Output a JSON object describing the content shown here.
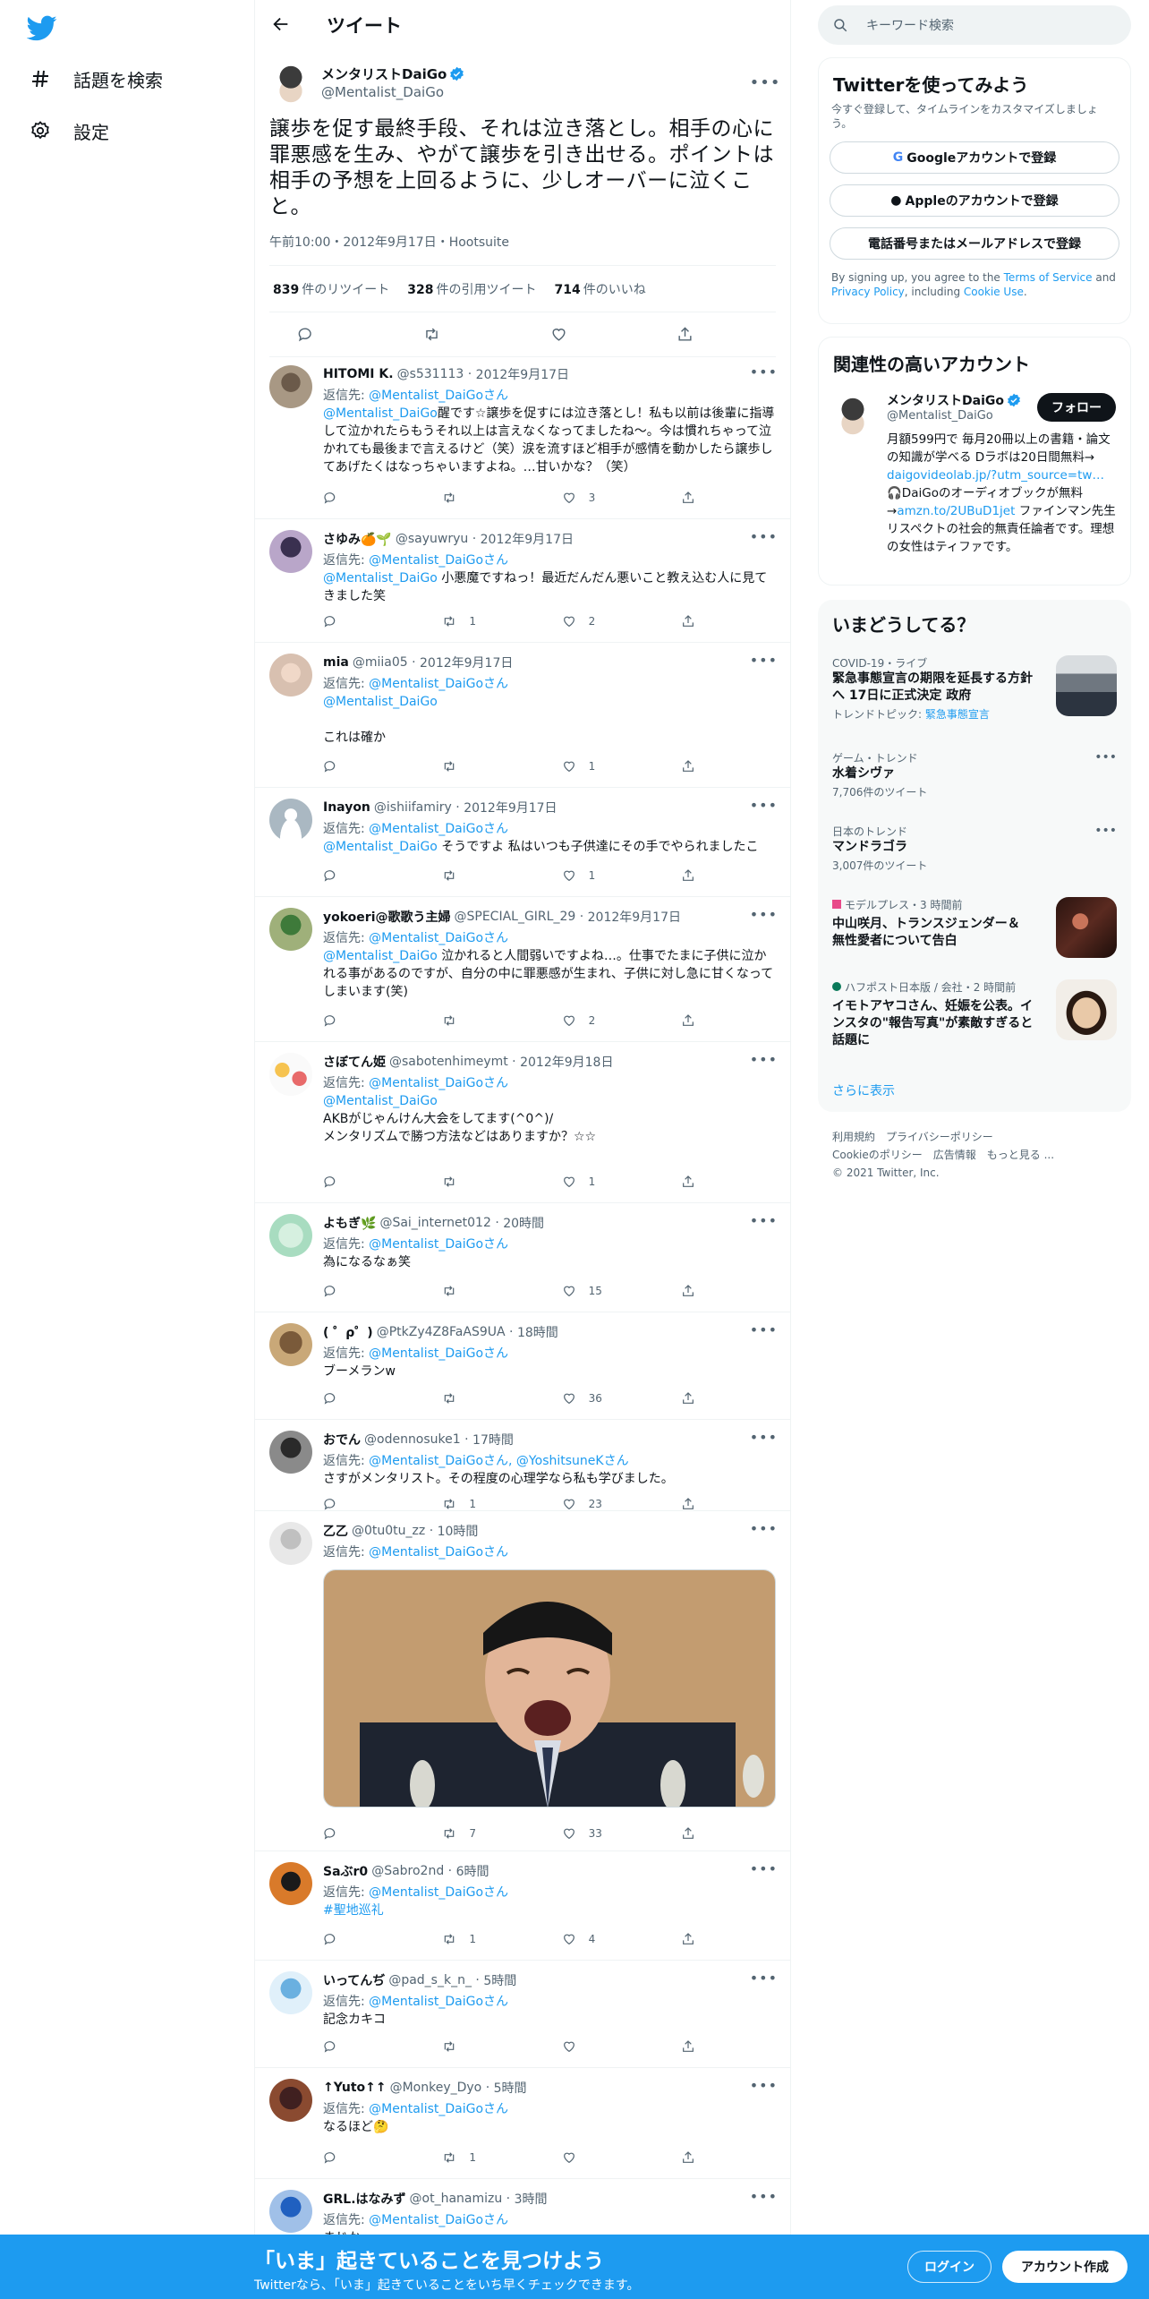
{
  "nav": {
    "explore": "話題を検索",
    "settings": "設定"
  },
  "header": {
    "title": "ツイート"
  },
  "tweet": {
    "name": "メンタリストDaiGo",
    "handle": "@Mentalist_DaiGo",
    "text": "譲歩を促す最終手段、それは泣き落とし。相手の心に罪悪感を生み、やがて譲歩を引き出せる。ポイントは相手の予想を上回るように、少しオーバーに泣くこと。",
    "meta": "午前10:00・2012年9月17日・Hootsuite",
    "retweets_n": "839",
    "retweets_l": "件のリツイート",
    "quotes_n": "328",
    "quotes_l": "件の引用ツイート",
    "likes_n": "714",
    "likes_l": "件のいいね"
  },
  "reply_label": "返信先:",
  "replies": [
    {
      "name": "HITOMI K.",
      "handle": "@s531113",
      "time": "2012年9月17日",
      "to": "@Mentalist_DaiGoさん",
      "text": "@Mentalist_DaiGo醒です☆譲歩を促すには泣き落とし！私も以前は後輩に指導して泣かれたらもうそれ以上は言えなくなってましたね〜。今は慣れちゃって泣かれても最後まで言えるけど（笑）涙を流すほど相手が感情を動かしたら譲歩してあげたくはなっちゃいますよね。…甘いかな？（笑）",
      "replies": "",
      "retweets": "",
      "likes": "3"
    },
    {
      "name": "さゆみ🍊🌱",
      "handle": "@sayuwryu",
      "time": "2012年9月17日",
      "to": "@Mentalist_DaiGoさん",
      "text": "@Mentalist_DaiGo 小悪魔ですねっ！最近だんだん悪いこと教え込む人に見てきました笑",
      "replies": "",
      "retweets": "1",
      "likes": "2"
    },
    {
      "name": "mia",
      "handle": "@miia05",
      "time": "2012年9月17日",
      "to": "@Mentalist_DaiGoさん",
      "text": "@Mentalist_DaiGo\n\nこれは確か",
      "replies": "",
      "retweets": "",
      "likes": "1"
    },
    {
      "name": "Inayon",
      "handle": "@ishiifamiry",
      "time": "2012年9月17日",
      "to": "@Mentalist_DaiGoさん",
      "text": "@Mentalist_DaiGo そうですよ 私はいつも子供達にその手でやられましたこ",
      "replies": "",
      "retweets": "",
      "likes": "1"
    },
    {
      "name": "yokoeri@歌歌う主婦",
      "handle": "@SPECIAL_GIRL_29",
      "time": "2012年9月17日",
      "to": "@Mentalist_DaiGoさん",
      "text": "@Mentalist_DaiGo 泣かれると人間弱いですよね…。仕事でたまに子供に泣かれる事があるのですが、自分の中に罪悪感が生まれ、子供に対し急に甘くなってしまいます(笑)",
      "replies": "",
      "retweets": "",
      "likes": "2"
    },
    {
      "name": "さぼてん姫",
      "handle": "@sabotenhimeymt",
      "time": "2012年9月18日",
      "to": "@Mentalist_DaiGoさん",
      "text": "@Mentalist_DaiGo\nAKBがじゃんけん大会をしてます(^0^)/\nメンタリズムで勝つ方法などはありますか？☆☆",
      "replies": "",
      "retweets": "",
      "likes": "1"
    },
    {
      "name": "よもぎ🌿",
      "handle": "@Sai_internet012",
      "time": "20時間",
      "to": "@Mentalist_DaiGoさん",
      "text": "為になるなぁ笑",
      "replies": "",
      "retweets": "",
      "likes": "15"
    },
    {
      "name": "( ゜ρ゜)",
      "handle": "@PtkZy4Z8FaAS9UA",
      "time": "18時間",
      "to": "@Mentalist_DaiGoさん",
      "text": "ブーメランw",
      "replies": "",
      "retweets": "",
      "likes": "36"
    },
    {
      "name": "おでん",
      "handle": "@odennosuke1",
      "time": "17時間",
      "to": "@Mentalist_DaiGoさん, @YoshitsuneKさん",
      "text": "さすがメンタリスト。その程度の心理学なら私も学びました。",
      "replies": "",
      "retweets": "1",
      "likes": "23"
    },
    {
      "name": "乙乙",
      "handle": "@0tu0tu_zz",
      "time": "10時間",
      "to": "@Mentalist_DaiGoさん",
      "text": "",
      "replies": "",
      "retweets": "7",
      "likes": "33"
    },
    {
      "name": "Saぶr0",
      "handle": "@Sabro2nd",
      "time": "6時間",
      "to": "@Mentalist_DaiGoさん",
      "text": "#聖地巡礼",
      "replies": "",
      "retweets": "1",
      "likes": "4"
    },
    {
      "name": "いってんぢ",
      "handle": "@pad_s_k_n_",
      "time": "5時間",
      "to": "@Mentalist_DaiGoさん",
      "text": "記念カキコ",
      "replies": "",
      "retweets": "",
      "likes": ""
    },
    {
      "name": "↑Yuto↑↑",
      "handle": "@Monkey_Dyo",
      "time": "5時間",
      "to": "@Mentalist_DaiGoさん",
      "text": "なるほど🤔",
      "replies": "",
      "retweets": "1",
      "likes": ""
    },
    {
      "name": "GRL.はなみず",
      "handle": "@ot_hanamizu",
      "time": "3時間",
      "to": "@Mentalist_DaiGoさん",
      "text": "まじか",
      "replies": "",
      "retweets": "",
      "likes": ""
    }
  ],
  "search": {
    "placeholder": "キーワード検索"
  },
  "signup_card": {
    "title": "Twitterを使ってみよう",
    "subtitle": "今すぐ登録して、タイムラインをカスタマイズしましょう。",
    "google": "Googleアカウントで登録",
    "apple": "Appleのアカウントで登録",
    "phone": "電話番号またはメールアドレスで登録",
    "legal_pre": "By signing up, you agree to the ",
    "tos": "Terms of Service",
    "and": " and ",
    "privacy": "Privacy Policy",
    "including": ", including ",
    "cookie": "Cookie Use",
    "dot": "."
  },
  "related": {
    "title": "関連性の高いアカウント",
    "name": "メンタリストDaiGo",
    "handle": "@Mentalist_DaiGo",
    "follow": "フォロー",
    "bio1": "月額599円で 毎月20冊以上の書籍・論文の知識が学べる Dラボは20日間無料→ ",
    "bio_link1": "daigovideolab.jp/?utm_source=tw…",
    "bio2": " 🎧DaiGoのオーディオブックが無料→",
    "bio_link2": "amzn.to/2UBuD1jet",
    "bio3": " ファインマン先生リスペクトの社会的無責任論者です。理想の女性はティファです。"
  },
  "trends": {
    "title": "いまどうしてる？",
    "items": [
      {
        "cat": "COVID-19・ライブ",
        "title": "緊急事態宣言の期限を延長する方針へ 17日に正式決定 政府",
        "sub_pre": "トレンドトピック: ",
        "sub_link": "緊急事態宣言"
      },
      {
        "cat": "ゲーム・トレンド",
        "title": "水着シヴァ",
        "sub": "7,706件のツイート"
      },
      {
        "cat": "日本のトレンド",
        "title": "マンドラゴラ",
        "sub": "3,007件のツイート"
      },
      {
        "cat": "モデルプレス",
        "time": "・3 時間前",
        "title": "中山咲月、トランスジェンダー＆無性愛者について告白"
      },
      {
        "cat": "ハフポスト日本版 / 会社",
        "time": "・2 時間前",
        "title": "イモトアヤコさん、妊娠を公表。インスタの\"報告写真\"が素敵すぎると話題に"
      }
    ],
    "more": "さらに表示"
  },
  "footer": {
    "terms": "利用規約",
    "privacy": "プライバシーポリシー",
    "cookie": "Cookieのポリシー",
    "ads": "広告情報",
    "more": "もっと見る ...",
    "copyright": "© 2021 Twitter, Inc."
  },
  "bottom": {
    "title": "「いま」起きていることを見つけよう",
    "subtitle": "Twitterなら、「いま」起きていることをいち早くチェックできます。",
    "login": "ログイン",
    "signup": "アカウント作成"
  },
  "colors": {
    "accent": "#1d9bf0",
    "text": "#0f1419",
    "muted": "#536471"
  }
}
